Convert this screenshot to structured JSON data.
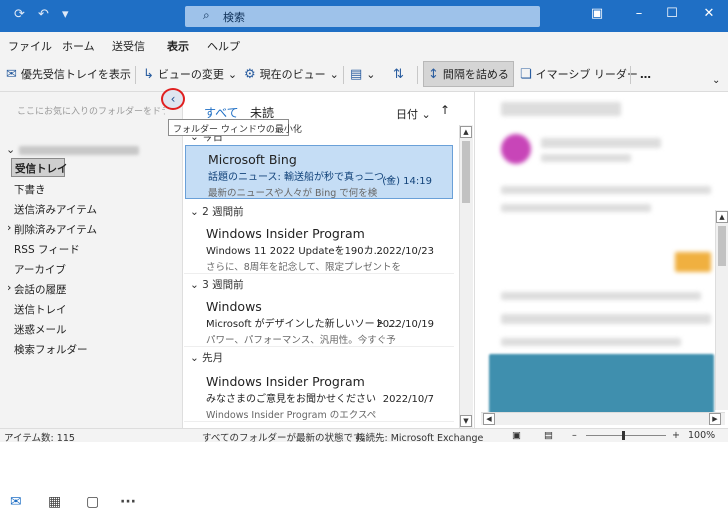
{
  "titlebar": {
    "search_placeholder": "検索"
  },
  "menu": {
    "items": [
      "ファイル",
      "ホーム",
      "送受信",
      "表示",
      "ヘルプ"
    ],
    "active": "表示"
  },
  "ribbon": {
    "focused_inbox": "優先受信トレイを表示",
    "change_view": "ビューの変更",
    "current_view": "現在のビュー",
    "compact_spacing": "間隔を詰める",
    "immersive_reader": "イマーシブ リーダー",
    "more": "…"
  },
  "folder_pane": {
    "favorites_hint": "ここにお気に入りのフォルダーをドラッグします",
    "collapse_tooltip": "フォルダー ウィンドウの最小化",
    "folders": [
      {
        "label": "受信トレイ",
        "selected": true
      },
      {
        "label": "下書き"
      },
      {
        "label": "送信済みアイテム"
      },
      {
        "label": "削除済みアイテム",
        "expandable": true
      },
      {
        "label": "RSS フィード"
      },
      {
        "label": "アーカイブ"
      },
      {
        "label": "会話の履歴",
        "expandable": true
      },
      {
        "label": "送信トレイ"
      },
      {
        "label": "迷惑メール"
      },
      {
        "label": "検索フォルダー"
      }
    ]
  },
  "message_list": {
    "tab_all": "すべて",
    "tab_unread": "未読",
    "sort_label": "日付",
    "groups": {
      "g_today": "今日",
      "g_2weeks": "2 週間前",
      "g_3weeks": "3 週間前",
      "g_lastmonth": "先月"
    },
    "messages": [
      {
        "sender": "Microsoft Bing",
        "subject": "話題のニュース: 輸送船が秒で真っ二つ...",
        "date": "(金) 14:19",
        "preview": "最新のニュースや人々が Bing で何を検"
      },
      {
        "sender": "Windows Insider Program",
        "subject": "Windows 11 2022 Updateを190カ...",
        "date": "2022/10/23",
        "preview": "さらに、8周年を記念して、限定プレゼントを"
      },
      {
        "sender": "Windows",
        "subject": "Microsoft がデザインした新しいソート ...",
        "date": "2022/10/19",
        "preview": "パワー、パフォーマンス、汎用性。今すぐ予"
      },
      {
        "sender": "Windows Insider Program",
        "subject": "みなさまのご意見をお聞かせください",
        "date": "2022/10/7",
        "preview": "Windows Insider Program のエクスペ"
      }
    ]
  },
  "statusbar": {
    "item_count": "アイテム数: 115",
    "sync_status": "すべてのフォルダーが最新の状態です。",
    "connection": "接続先: Microsoft Exchange",
    "zoom": "100%"
  },
  "colors": {
    "accent": "#1f6fc5",
    "selected_row": "#c5ddf5",
    "highlight_circle": "#e02020"
  }
}
